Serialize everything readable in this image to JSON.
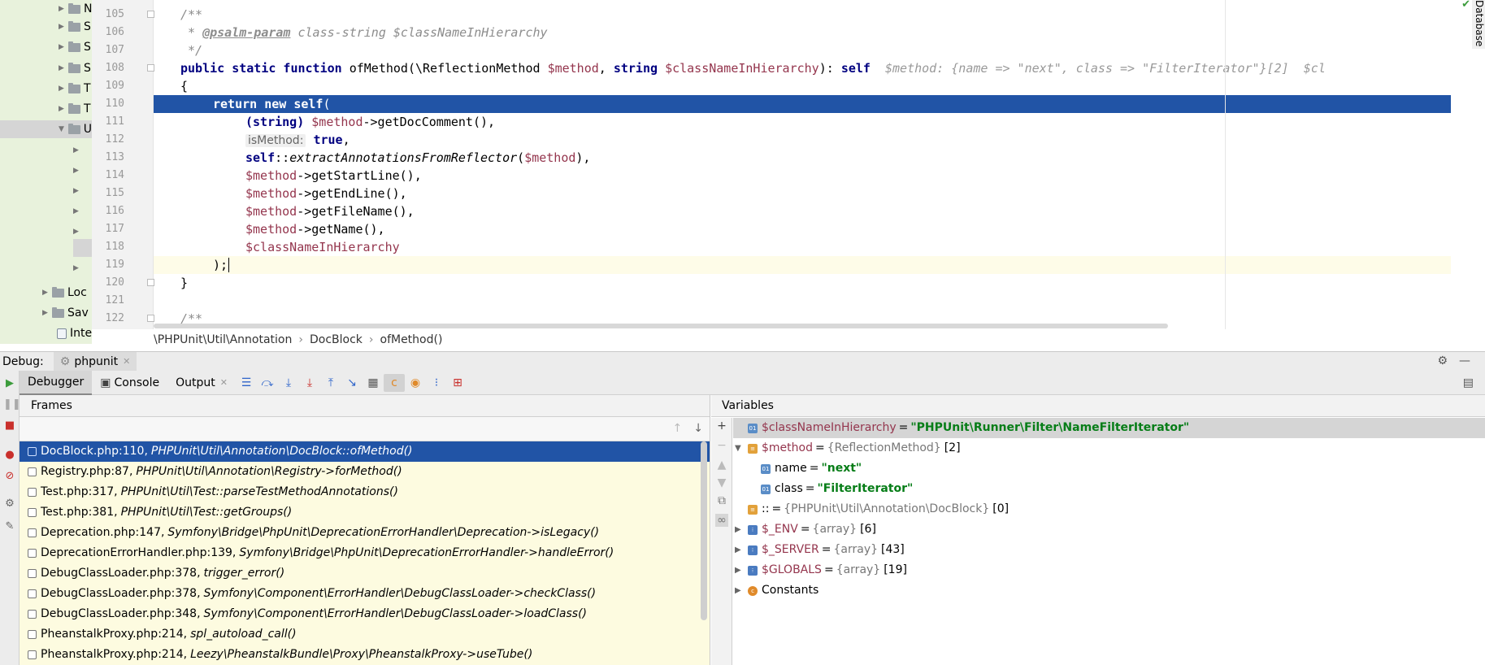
{
  "project_tree": {
    "items": [
      {
        "label": "N",
        "expanded": false
      },
      {
        "label": "S",
        "expanded": false
      },
      {
        "label": "S",
        "expanded": false
      },
      {
        "label": "S",
        "expanded": false
      },
      {
        "label": "T",
        "expanded": false
      },
      {
        "label": "T",
        "expanded": false
      },
      {
        "label": "U",
        "expanded": true
      },
      {
        "label": "",
        "expanded": false
      },
      {
        "label": "",
        "expanded": false
      },
      {
        "label": "",
        "expanded": false
      },
      {
        "label": "",
        "expanded": false
      },
      {
        "label": "",
        "expanded": false
      },
      {
        "label": "",
        "expanded": false
      },
      {
        "label": "",
        "expanded": false
      },
      {
        "label": "Loc",
        "expanded": false
      },
      {
        "label": "Sav",
        "expanded": false
      },
      {
        "label": "Inte",
        "expanded": false
      }
    ]
  },
  "editor": {
    "database_tab": "Database",
    "lines": [
      {
        "n": "105"
      },
      {
        "n": "106"
      },
      {
        "n": "107"
      },
      {
        "n": "108"
      },
      {
        "n": "109"
      },
      {
        "n": "110"
      },
      {
        "n": "111"
      },
      {
        "n": "112"
      },
      {
        "n": "113"
      },
      {
        "n": "114"
      },
      {
        "n": "115"
      },
      {
        "n": "116"
      },
      {
        "n": "117"
      },
      {
        "n": "118"
      },
      {
        "n": "119"
      },
      {
        "n": "120"
      },
      {
        "n": "121"
      },
      {
        "n": "122"
      }
    ],
    "code": {
      "l105": "/**",
      "l106_star": " * ",
      "l106_tag": "@psalm-param",
      "l106_rest": " class-string $classNameInHierarchy",
      "l107": " */",
      "l108_kw1": "public static function",
      "l108_fn": " ofMethod(\\ReflectionMethod ",
      "l108_v1": "$method",
      "l108_p2": ", ",
      "l108_kw2": "string",
      "l108_sp": " ",
      "l108_v2": "$classNameInHierarchy",
      "l108_p3": "): ",
      "l108_kw3": "self",
      "l108_hint": "  $method: {name => \"next\", class => \"FilterIterator\"}[2]  $cl",
      "l109": "{",
      "l110_kw": "return new self",
      "l110_p": "(",
      "l111_kw": "(string)",
      "l111_v": " $method",
      "l111_rest": "->getDocComment(),",
      "l112_inlay": "isMethod:",
      "l112_kw": " true",
      "l112_rest": ",",
      "l113_kw": "self",
      "l113_p": "::",
      "l113_fn": "extractAnnotationsFromReflector",
      "l113_p2": "(",
      "l113_v": "$method",
      "l113_p3": "),",
      "l114_v": "$method",
      "l114_rest": "->getStartLine(),",
      "l115_v": "$method",
      "l115_rest": "->getEndLine(),",
      "l116_v": "$method",
      "l116_rest": "->getFileName(),",
      "l117_v": "$method",
      "l117_rest": "->getName(),",
      "l118_v": "$classNameInHierarchy",
      "l119": ");",
      "l120": "}",
      "l122": "/**"
    }
  },
  "breadcrumb": [
    "\\PHPUnit\\Util\\Annotation",
    "DocBlock",
    "ofMethod()"
  ],
  "debug": {
    "label": "Debug:",
    "session_tab": "phpunit",
    "tabs": [
      "Debugger",
      "Console",
      "Output"
    ],
    "frames_title": "Frames",
    "variables_title": "Variables",
    "frames": [
      {
        "file": "DocBlock.php:110,",
        "sig": "PHPUnit\\Util\\Annotation\\DocBlock::ofMethod()"
      },
      {
        "file": "Registry.php:87,",
        "sig": "PHPUnit\\Util\\Annotation\\Registry->forMethod()"
      },
      {
        "file": "Test.php:317,",
        "sig": "PHPUnit\\Util\\Test::parseTestMethodAnnotations()"
      },
      {
        "file": "Test.php:381,",
        "sig": "PHPUnit\\Util\\Test::getGroups()"
      },
      {
        "file": "Deprecation.php:147,",
        "sig": "Symfony\\Bridge\\PhpUnit\\DeprecationErrorHandler\\Deprecation->isLegacy()"
      },
      {
        "file": "DeprecationErrorHandler.php:139,",
        "sig": "Symfony\\Bridge\\PhpUnit\\DeprecationErrorHandler->handleError()"
      },
      {
        "file": "DebugClassLoader.php:378,",
        "sig": "trigger_error()"
      },
      {
        "file": "DebugClassLoader.php:378,",
        "sig": "Symfony\\Component\\ErrorHandler\\DebugClassLoader->checkClass()"
      },
      {
        "file": "DebugClassLoader.php:348,",
        "sig": "Symfony\\Component\\ErrorHandler\\DebugClassLoader->loadClass()"
      },
      {
        "file": "PheanstalkProxy.php:214,",
        "sig": "spl_autoload_call()"
      },
      {
        "file": "PheanstalkProxy.php:214,",
        "sig": "Leezy\\PheanstalkBundle\\Proxy\\PheanstalkProxy->useTube()"
      }
    ],
    "variables": [
      {
        "name": "$classNameInHierarchy",
        "eq": "=",
        "str": "\"PHPUnit\\Runner\\Filter\\NameFilterIterator\"",
        "type": "",
        "count": ""
      },
      {
        "name": "$method",
        "eq": "=",
        "str": "",
        "type": "{ReflectionMethod}",
        "count": "[2]"
      },
      {
        "name": "name",
        "eq": "=",
        "str": "\"next\"",
        "type": "",
        "count": ""
      },
      {
        "name": "class",
        "eq": "=",
        "str": "\"FilterIterator\"",
        "type": "",
        "count": ""
      },
      {
        "name": "::",
        "eq": "=",
        "str": "",
        "type": "{PHPUnit\\Util\\Annotation\\DocBlock}",
        "count": "[0]"
      },
      {
        "name": "$_ENV",
        "eq": "=",
        "str": "",
        "type": "{array}",
        "count": "[6]"
      },
      {
        "name": "$_SERVER",
        "eq": "=",
        "str": "",
        "type": "{array}",
        "count": "[43]"
      },
      {
        "name": "$GLOBALS",
        "eq": "=",
        "str": "",
        "type": "{array}",
        "count": "[19]"
      },
      {
        "name": "Constants",
        "eq": "",
        "str": "",
        "type": "",
        "count": ""
      }
    ]
  }
}
